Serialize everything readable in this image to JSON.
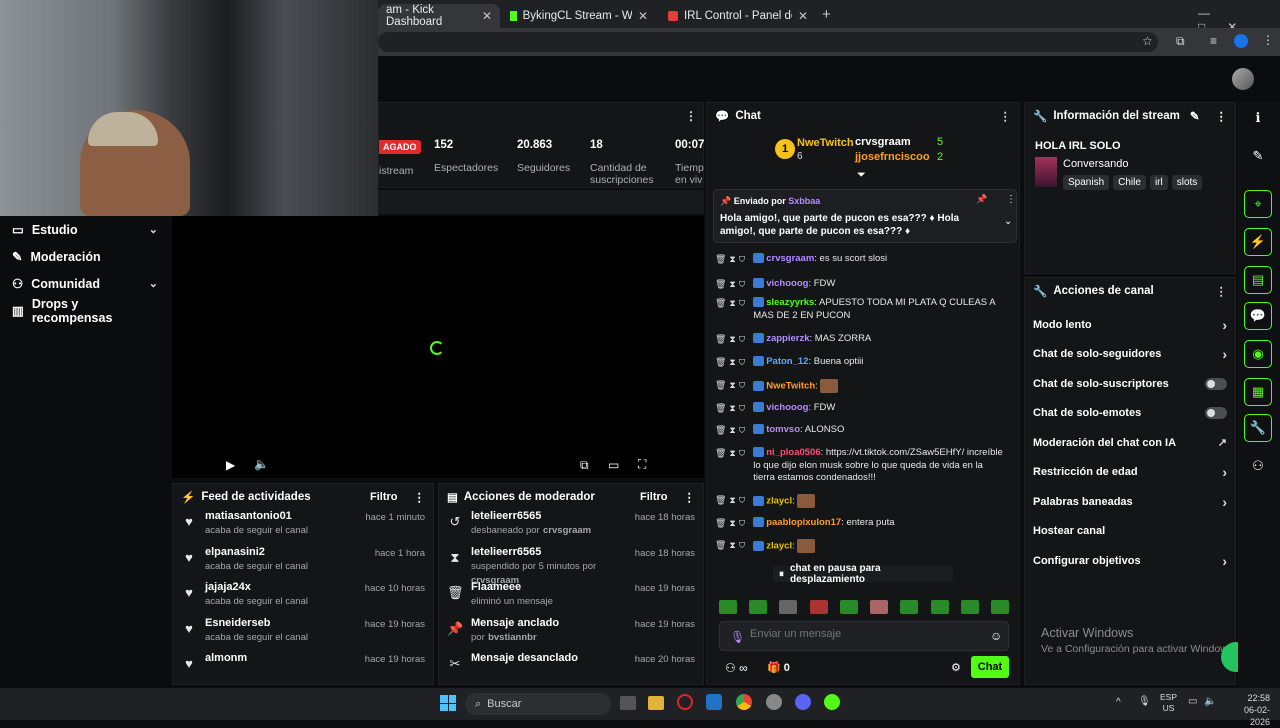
{
  "browser": {
    "tabs": [
      {
        "label": "am - Kick Dashboard"
      },
      {
        "label": "BykingCL Stream - Watch Live o"
      },
      {
        "label": "IRL Control - Panel de Control d"
      }
    ],
    "new_tab": "+"
  },
  "stats": {
    "status_badge": "AGADO",
    "stream_label": "istream",
    "viewers": {
      "value": "152",
      "label": "Espectadores"
    },
    "followers": {
      "value": "20.863",
      "label": "Seguidores"
    },
    "subs": {
      "value": "18",
      "label": "Cantidad de suscripciones"
    },
    "time": {
      "value": "00:07:",
      "label": "Tiemp en viv"
    }
  },
  "sidebar": {
    "items": [
      {
        "label": "Estudio",
        "icon": "studio-icon"
      },
      {
        "label": "Moderación",
        "icon": "wrench-icon"
      },
      {
        "label": "Comunidad",
        "icon": "users-icon"
      },
      {
        "label": "Drops y recompensas",
        "icon": "chart-icon"
      }
    ]
  },
  "activity": {
    "title": "Feed de actividades",
    "filter": "Filtro",
    "items": [
      {
        "user": "matiasantonio01",
        "desc": "acaba de seguir el canal",
        "time": "hace 1 minuto"
      },
      {
        "user": "elpanasini2",
        "desc": "acaba de seguir el canal",
        "time": "hace 1 hora"
      },
      {
        "user": "jajaja24x",
        "desc": "acaba de seguir el canal",
        "time": "hace 10 horas"
      },
      {
        "user": "Esneiderseb",
        "desc": "acaba de seguir el canal",
        "time": "hace 19 horas"
      },
      {
        "user": "almonm",
        "desc": "",
        "time": "hace 19 horas"
      }
    ]
  },
  "modactions": {
    "title": "Acciones de moderador",
    "filter": "Filtro",
    "items": [
      {
        "title": "letelieerr6565",
        "desc": "desbaneado por",
        "by": "crvsgraam",
        "time": "hace 18 horas"
      },
      {
        "title": "letelieerr6565",
        "desc": "suspendido por 5 minutos por",
        "by": "crvsgraam",
        "time": "hace 18 horas"
      },
      {
        "title": "Flaameee",
        "desc": "eliminó un mensaje",
        "by": "",
        "time": "hace 19 horas"
      },
      {
        "title": "Mensaje anclado",
        "desc": "por",
        "by": "bvstiannbr",
        "time": "hace 19 horas"
      },
      {
        "title": "Mensaje desanclado",
        "desc": "",
        "by": "",
        "time": "hace 20 horas"
      }
    ]
  },
  "chat": {
    "title": "Chat",
    "top_gifters": [
      {
        "rank": "1",
        "name": "NweTwitch",
        "count": "6"
      },
      {
        "name": "crvsgraam",
        "count": "5"
      },
      {
        "name": "jjosefrnciscoo",
        "count": "2"
      }
    ],
    "pinned": {
      "label": "Enviado por",
      "user": "Sxbbaa",
      "text": "Hola amigo!, que parte de pucon es esa??? ♦ Hola amigo!, que parte de pucon es esa??? ♦"
    },
    "messages": [
      {
        "user": "crvsgraam",
        "text": ": es su scort slosi",
        "color": "#b48cff"
      },
      {
        "user": "vichooog",
        "text": ": FDW",
        "color": "#b48cff"
      },
      {
        "user": "sleazyyrks",
        "text": ": APUESTO TODA MI PLATA Q CULEAS A MAS DE 2 EN PUCON",
        "color": "#53fc18"
      },
      {
        "user": "zappierzk",
        "text": ": MAS ZORRA",
        "color": "#b48cff"
      },
      {
        "user": "Paton_12",
        "text": ": Buena optiii",
        "color": "#5aa9ff"
      },
      {
        "user": "NweTwitch",
        "text": ":",
        "color": "#ff9d2b"
      },
      {
        "user": "vichooog",
        "text": ": FDW",
        "color": "#b48cff"
      },
      {
        "user": "tomvso",
        "text": ": ALONSO",
        "color": "#b48cff"
      },
      {
        "user": "ni_ploa0506",
        "text": ": https://vt.tiktok.com/ZSaw5EHfY/ increíble lo que dijo elon musk sobre lo que queda de vida en la tierra estamos condenados!!!",
        "color": "#ff4d7a"
      },
      {
        "user": "zlaycl",
        "text": ":",
        "color": "#e0c100"
      },
      {
        "user": "paablopixulon17",
        "text": ": entera puta",
        "color": "#ff9d2b"
      },
      {
        "user": "zlaycl",
        "text": ":",
        "color": "#e0c100"
      }
    ],
    "paused": "chat en pausa para desplazamiento",
    "input_placeholder": "Enviar un mensaje",
    "points": "0",
    "infinity": "∞",
    "send": "Chat"
  },
  "stream_info": {
    "title": "Información del stream",
    "stream_title": "HOLA IRL SOLO",
    "category": "Conversando",
    "tags": [
      "Spanish",
      "Chile",
      "irl",
      "slots"
    ]
  },
  "channel_actions": {
    "title": "Acciones de canal",
    "items": [
      {
        "label": "Modo lento",
        "kind": "arrow"
      },
      {
        "label": "Chat de solo-seguidores",
        "kind": "arrow"
      },
      {
        "label": "Chat de solo-suscriptores",
        "kind": "toggle"
      },
      {
        "label": "Chat de solo-emotes",
        "kind": "toggle"
      },
      {
        "label": "Moderación del chat con IA",
        "kind": "external"
      },
      {
        "label": "Restricción de edad",
        "kind": "arrow"
      },
      {
        "label": "Palabras baneadas",
        "kind": "arrow"
      },
      {
        "label": "Hostear canal",
        "kind": "none"
      },
      {
        "label": "Configurar objetivos",
        "kind": "arrow"
      }
    ]
  },
  "watermark": {
    "line1": "Activar Windows",
    "line2": "Ve a Configuración para activar Windows."
  },
  "taskbar": {
    "search": "Buscar",
    "lang1": "ESP",
    "lang2": "US",
    "time": "22:58",
    "date": "06-02-2026"
  },
  "colors": {
    "accent": "#53fc18",
    "panel": "#141517"
  }
}
